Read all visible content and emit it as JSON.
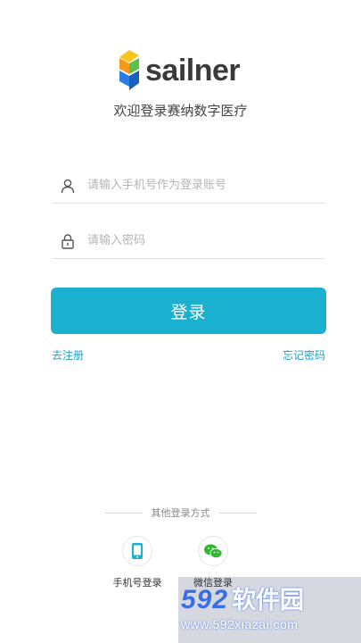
{
  "brand": {
    "name": "sailner",
    "tagline": "欢迎登录赛纳数字医疗"
  },
  "form": {
    "phone": {
      "placeholder": "请输入手机号作为登录账号",
      "value": ""
    },
    "password": {
      "placeholder": "请输入密码",
      "value": ""
    },
    "login_label": "登录"
  },
  "links": {
    "register": "去注册",
    "forgot": "忘记密码"
  },
  "other_login": {
    "title": "其他登录方式",
    "methods": [
      {
        "label": "手机号登录",
        "icon": "mobile-phone-icon",
        "color": "#1ab0cf"
      },
      {
        "label": "微信登录",
        "icon": "wechat-icon",
        "color": "#2dbb2d"
      }
    ]
  },
  "watermark": {
    "number": "592",
    "site_name": "软件园",
    "url": "www.592xiazai.com"
  },
  "colors": {
    "accent": "#1ab0cf",
    "link": "#1aa3c4",
    "wechat": "#2dbb2d",
    "logo_blue": "#2a7de1",
    "logo_orange": "#f39a1b",
    "logo_green": "#5cc04a",
    "logo_yellow": "#f7c51d"
  }
}
